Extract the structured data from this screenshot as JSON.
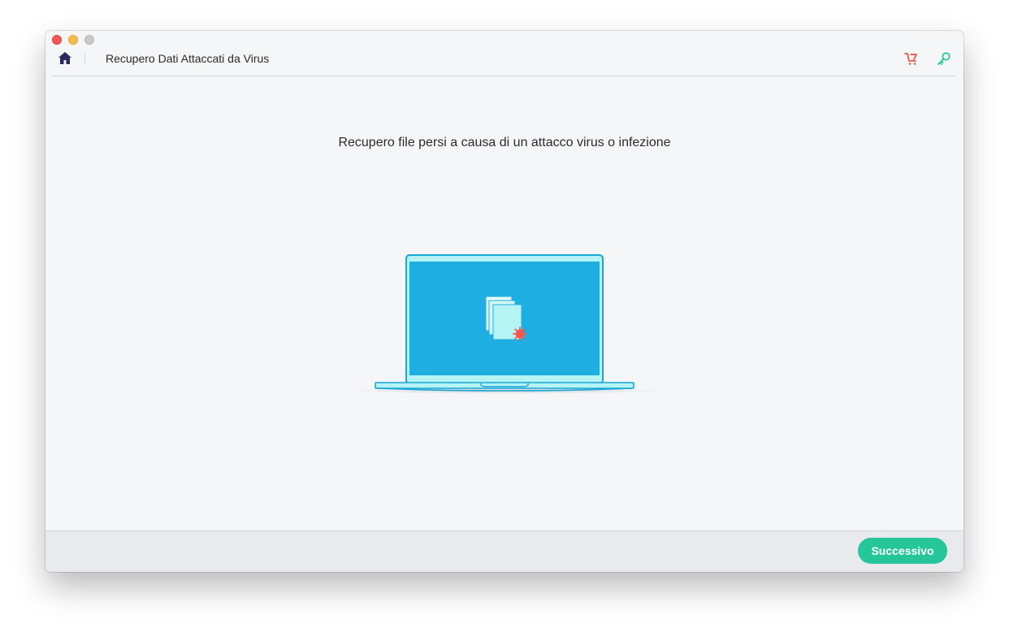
{
  "window": {
    "controls": [
      "close",
      "minimize",
      "maximize"
    ]
  },
  "header": {
    "home_icon": "home-icon",
    "title": "Recupero Dati Attaccati da Virus",
    "cart_icon": "cart-icon",
    "key_icon": "key-icon"
  },
  "main": {
    "heading": "Recupero file persi a causa di un attacco virus o infezione",
    "illustration": "laptop-virus-files-illustration"
  },
  "footer": {
    "next_label": "Successivo"
  },
  "colors": {
    "accent_green": "#26c59a",
    "cart_red": "#e8564a",
    "key_green": "#26c59a",
    "home_navy": "#2b2a5e",
    "screen_blue": "#1eaee2",
    "frame_cyan": "#b6f3f4",
    "virus_red": "#f35a4e"
  }
}
